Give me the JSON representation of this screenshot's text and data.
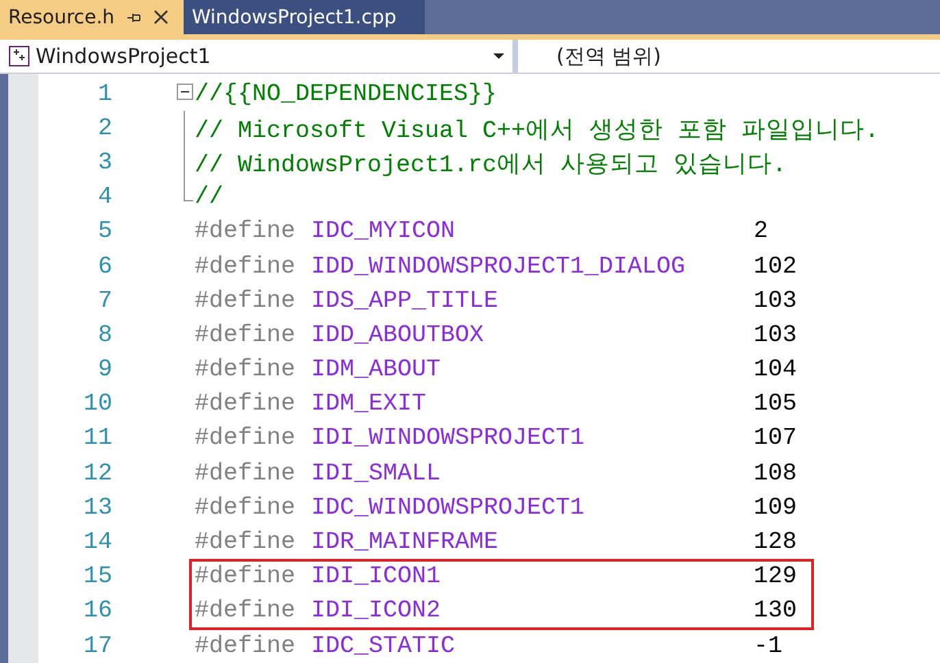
{
  "tabs": [
    {
      "label": "Resource.h",
      "selected": true
    },
    {
      "label": "WindowsProject1.cpp",
      "selected": false
    }
  ],
  "navigation": {
    "project": "WindowsProject1",
    "scope": "(전역 범위)"
  },
  "lines": [
    {
      "number": "1",
      "kind": "comment",
      "text": "//{{NO_DEPENDENCIES}}",
      "highlighted": false
    },
    {
      "number": "2",
      "kind": "comment",
      "text": "// Microsoft Visual C++에서 생성한 포함 파일입니다.",
      "highlighted": false
    },
    {
      "number": "3",
      "kind": "comment",
      "text": "// WindowsProject1.rc에서 사용되고 있습니다.",
      "highlighted": false
    },
    {
      "number": "4",
      "kind": "comment",
      "text": "//",
      "highlighted": false
    },
    {
      "number": "5",
      "kind": "define",
      "keyword": "#define",
      "name": "IDC_MYICON",
      "value": "2",
      "highlighted": false
    },
    {
      "number": "6",
      "kind": "define",
      "keyword": "#define",
      "name": "IDD_WINDOWSPROJECT1_DIALOG",
      "value": "102",
      "highlighted": false
    },
    {
      "number": "7",
      "kind": "define",
      "keyword": "#define",
      "name": "IDS_APP_TITLE",
      "value": "103",
      "highlighted": false
    },
    {
      "number": "8",
      "kind": "define",
      "keyword": "#define",
      "name": "IDD_ABOUTBOX",
      "value": "103",
      "highlighted": false
    },
    {
      "number": "9",
      "kind": "define",
      "keyword": "#define",
      "name": "IDM_ABOUT",
      "value": "104",
      "highlighted": false
    },
    {
      "number": "10",
      "kind": "define",
      "keyword": "#define",
      "name": "IDM_EXIT",
      "value": "105",
      "highlighted": false
    },
    {
      "number": "11",
      "kind": "define",
      "keyword": "#define",
      "name": "IDI_WINDOWSPROJECT1",
      "value": "107",
      "highlighted": false
    },
    {
      "number": "12",
      "kind": "define",
      "keyword": "#define",
      "name": "IDI_SMALL",
      "value": "108",
      "highlighted": false
    },
    {
      "number": "13",
      "kind": "define",
      "keyword": "#define",
      "name": "IDC_WINDOWSPROJECT1",
      "value": "109",
      "highlighted": false
    },
    {
      "number": "14",
      "kind": "define",
      "keyword": "#define",
      "name": "IDR_MAINFRAME",
      "value": "128",
      "highlighted": false
    },
    {
      "number": "15",
      "kind": "define",
      "keyword": "#define",
      "name": "IDI_ICON1",
      "value": "129",
      "highlighted": true
    },
    {
      "number": "16",
      "kind": "define",
      "keyword": "#define",
      "name": "IDI_ICON2",
      "value": "130",
      "highlighted": true
    },
    {
      "number": "17",
      "kind": "define",
      "keyword": "#define",
      "name": "IDC_STATIC",
      "value": "-1",
      "highlighted": false
    }
  ]
}
